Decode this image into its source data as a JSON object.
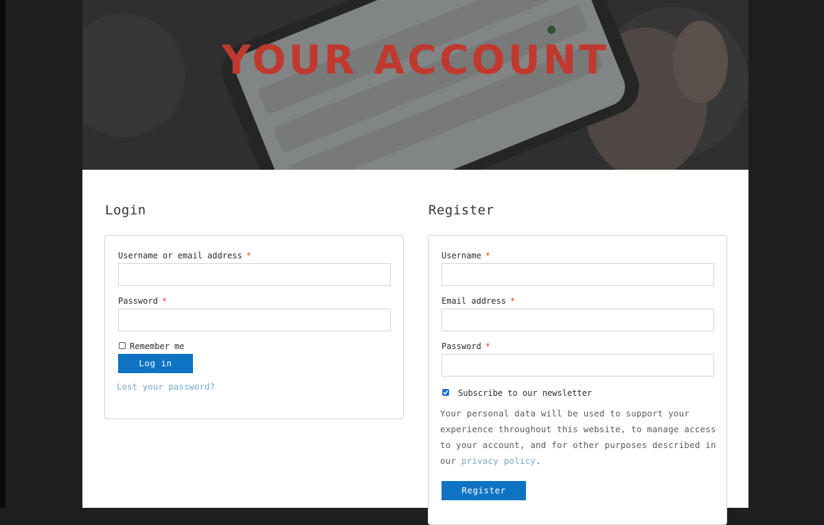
{
  "hero": {
    "title": "YOUR ACCOUNT"
  },
  "login": {
    "heading": "Login",
    "username_label": "Username or email address",
    "password_label": "Password",
    "required_mark": "*",
    "username_value": "",
    "password_value": "",
    "remember_label": "Remember me",
    "remember_checked": false,
    "submit_label": "Log in",
    "lost_password_link": "Lost your password?"
  },
  "register": {
    "heading": "Register",
    "username_label": "Username",
    "email_label": "Email address",
    "password_label": "Password",
    "required_mark": "*",
    "username_value": "",
    "email_value": "",
    "password_value": "",
    "newsletter_label": "Subscribe to our newsletter",
    "newsletter_checked": true,
    "privacy_text_1": "Your personal data will be used to support your experience throughout this website, to manage access to your account, and for other purposes described in our ",
    "privacy_link": "privacy policy",
    "privacy_text_2": ".",
    "submit_label": "Register"
  },
  "colors": {
    "hero_title": "#c0392f",
    "button": "#0f73c3",
    "link": "#74a8cc",
    "required": "#e2401c",
    "page_background": "#1e1e1e"
  }
}
